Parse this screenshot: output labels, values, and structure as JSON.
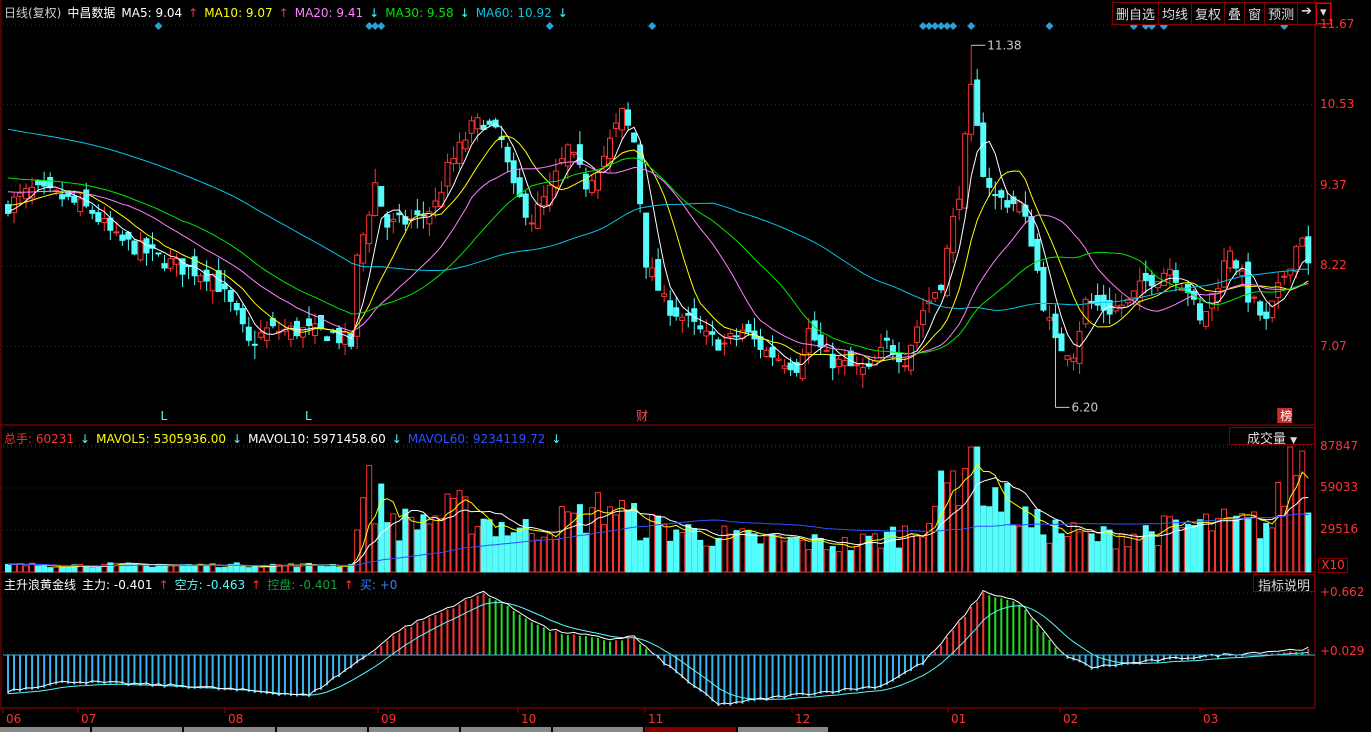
{
  "header": {
    "period": "日线(复权)",
    "stock": "中昌数据",
    "ma": [
      {
        "label": "MA5: 9.04",
        "dir": "up",
        "color": "#ffffff"
      },
      {
        "label": "MA10: 9.07",
        "dir": "up",
        "color": "#ffff00"
      },
      {
        "label": "MA20: 9.41",
        "dir": "down",
        "color": "#ff80ff"
      },
      {
        "label": "MA30: 9.58",
        "dir": "down",
        "color": "#00e600"
      },
      {
        "label": "MA60: 10.92",
        "dir": "down",
        "color": "#00c8e8"
      }
    ]
  },
  "toolbar": [
    "删自选",
    "均线",
    "复权",
    "叠",
    "窗",
    "预测"
  ],
  "price_axis": [
    "11.67",
    "10.53",
    "9.37",
    "8.22",
    "7.07"
  ],
  "annotations": {
    "high": "11.38",
    "low": "6.20",
    "markers": [
      {
        "text": "L",
        "bar": 26
      },
      {
        "text": "L",
        "bar": 50
      },
      {
        "text": "财",
        "bar": 105
      },
      {
        "text": "榜",
        "bar": 212
      }
    ]
  },
  "volume": {
    "legend": [
      {
        "label": "总手: 60231",
        "color": "#ff3232"
      },
      {
        "label": "MAVOL5: 5305936.00",
        "color": "#ffff00"
      },
      {
        "label": "MAVOL10: 5971458.60",
        "color": "#ffffff"
      },
      {
        "label": "MAVOL60: 9234119.72",
        "color": "#3050ff"
      }
    ],
    "selector": "成交量",
    "axis": [
      "87847",
      "59033",
      "29516"
    ],
    "unit": "X10"
  },
  "indicator": {
    "legend": [
      {
        "label": "主升浪黄金线",
        "color": "#ffffff"
      },
      {
        "label": "主力: -0.401",
        "color": "#ffffff",
        "dir": "up"
      },
      {
        "label": "空方: -0.463",
        "color": "#54fcfc",
        "dir": "up"
      },
      {
        "label": "控盘: -0.401",
        "color": "#10a040",
        "dir": "up"
      },
      {
        "label": "买: +0",
        "color": "#3080ff"
      }
    ],
    "button": "指标说明",
    "axis": [
      "+0.662",
      "+0.029"
    ]
  },
  "months": [
    "06",
    "07",
    "08",
    "09",
    "10",
    "11",
    "12",
    "01",
    "02",
    "03"
  ],
  "chart_data": {
    "type": "candlestick",
    "bars": 217,
    "close_keypoints": [
      [
        0,
        9.1
      ],
      [
        4,
        9.3
      ],
      [
        9,
        9.2
      ],
      [
        14,
        9.0
      ],
      [
        18,
        8.6
      ],
      [
        21,
        8.5
      ],
      [
        26,
        8.3
      ],
      [
        29,
        8.2
      ],
      [
        34,
        8.1
      ],
      [
        38,
        7.5
      ],
      [
        40,
        7.1
      ],
      [
        43,
        7.3
      ],
      [
        49,
        7.3
      ],
      [
        54,
        7.25
      ],
      [
        57,
        7.1
      ],
      [
        58,
        8.3
      ],
      [
        61,
        9.4
      ],
      [
        63,
        8.8
      ],
      [
        68,
        8.9
      ],
      [
        71,
        9.1
      ],
      [
        73,
        9.6
      ],
      [
        77,
        10.2
      ],
      [
        79,
        10.3
      ],
      [
        82,
        10.0
      ],
      [
        84,
        9.3
      ],
      [
        87,
        8.9
      ],
      [
        90,
        9.3
      ],
      [
        93,
        9.9
      ],
      [
        96,
        9.4
      ],
      [
        99,
        9.8
      ],
      [
        102,
        10.4
      ],
      [
        104,
        10.0
      ],
      [
        106,
        8.3
      ],
      [
        109,
        7.7
      ],
      [
        112,
        7.5
      ],
      [
        116,
        7.2
      ],
      [
        119,
        7.1
      ],
      [
        122,
        7.3
      ],
      [
        126,
        7.0
      ],
      [
        131,
        6.8
      ],
      [
        133,
        7.3
      ],
      [
        136,
        6.9
      ],
      [
        139,
        6.8
      ],
      [
        143,
        6.7
      ],
      [
        146,
        7.1
      ],
      [
        149,
        6.9
      ],
      [
        152,
        7.6
      ],
      [
        155,
        8.0
      ],
      [
        158,
        9.3
      ],
      [
        160,
        10.7
      ],
      [
        162,
        9.6
      ],
      [
        164,
        9.2
      ],
      [
        168,
        9.1
      ],
      [
        170,
        8.6
      ],
      [
        172,
        7.7
      ],
      [
        174,
        7.1
      ],
      [
        177,
        7.0
      ],
      [
        179,
        7.7
      ],
      [
        183,
        7.6
      ],
      [
        186,
        7.7
      ],
      [
        189,
        8.0
      ],
      [
        193,
        8.2
      ],
      [
        196,
        7.9
      ],
      [
        198,
        7.4
      ],
      [
        201,
        8.0
      ],
      [
        203,
        8.5
      ],
      [
        206,
        7.8
      ],
      [
        209,
        7.4
      ],
      [
        212,
        8.1
      ],
      [
        215,
        8.7
      ],
      [
        216,
        8.2
      ]
    ],
    "volume_keypoints": [
      [
        0,
        5000
      ],
      [
        57,
        5000
      ],
      [
        58,
        45000
      ],
      [
        60,
        60000
      ],
      [
        65,
        35000
      ],
      [
        75,
        45000
      ],
      [
        85,
        30000
      ],
      [
        95,
        40000
      ],
      [
        100,
        50000
      ],
      [
        105,
        35000
      ],
      [
        120,
        25000
      ],
      [
        140,
        20000
      ],
      [
        150,
        30000
      ],
      [
        155,
        55000
      ],
      [
        160,
        88000
      ],
      [
        163,
        60000
      ],
      [
        170,
        35000
      ],
      [
        180,
        25000
      ],
      [
        190,
        30000
      ],
      [
        200,
        35000
      ],
      [
        210,
        35000
      ],
      [
        213,
        80000
      ],
      [
        215,
        85000
      ],
      [
        216,
        45000
      ]
    ],
    "osc_keypoints": [
      [
        0,
        -0.4
      ],
      [
        10,
        -0.3
      ],
      [
        30,
        -0.35
      ],
      [
        50,
        -0.45
      ],
      [
        59,
        -0.05
      ],
      [
        65,
        0.25
      ],
      [
        79,
        0.66
      ],
      [
        90,
        0.25
      ],
      [
        100,
        0.15
      ],
      [
        104,
        0.18
      ],
      [
        107,
        0
      ],
      [
        118,
        -0.55
      ],
      [
        130,
        -0.45
      ],
      [
        145,
        -0.35
      ],
      [
        152,
        -0.1
      ],
      [
        155,
        0.1
      ],
      [
        162,
        0.66
      ],
      [
        168,
        0.55
      ],
      [
        175,
        0
      ],
      [
        180,
        -0.15
      ],
      [
        195,
        -0.05
      ],
      [
        216,
        0.05
      ]
    ],
    "price_range": [
      6.2,
      11.67
    ],
    "volume_range": [
      0,
      87847
    ],
    "osc_range": [
      -0.6,
      0.662
    ],
    "signal_bars": [
      25,
      60,
      61,
      62,
      90,
      107,
      152,
      153,
      154,
      155,
      156,
      157,
      160,
      173,
      187,
      189,
      190,
      192,
      212
    ]
  }
}
